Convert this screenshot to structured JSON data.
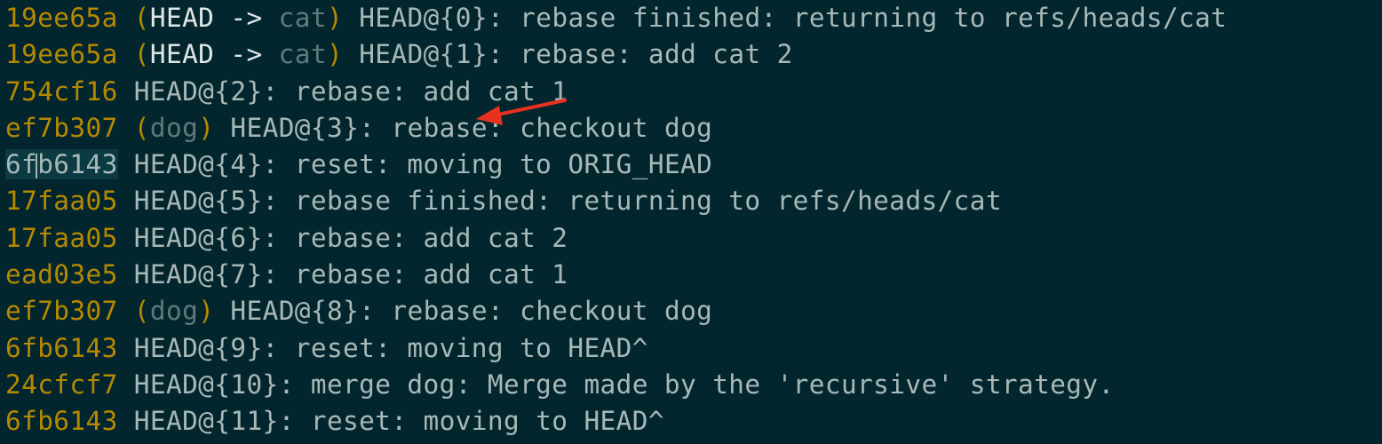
{
  "terminal": {
    "lines": [
      {
        "hash": "19ee65a",
        "open_paren": "(",
        "head": "HEAD",
        "arrow": " -> ",
        "branch": "cat",
        "close_paren": ")",
        "reflog": "HEAD@{0}:",
        "message": "rebase finished: returning to refs/heads/cat"
      },
      {
        "hash": "19ee65a",
        "open_paren": "(",
        "head": "HEAD",
        "arrow": " -> ",
        "branch": "cat",
        "close_paren": ")",
        "reflog": "HEAD@{1}:",
        "message": "rebase: add cat 2"
      },
      {
        "hash": "754cf16",
        "reflog": "HEAD@{2}:",
        "message": "rebase: add cat 1"
      },
      {
        "hash": "ef7b307",
        "open_paren": "(",
        "branch": "dog",
        "close_paren": ")",
        "reflog": "HEAD@{3}:",
        "message": "rebase: checkout dog"
      },
      {
        "hash_part1": "6f",
        "hash_part2": "b6143",
        "reflog": "HEAD@{4}:",
        "message": "reset: moving to ORIG_HEAD"
      },
      {
        "hash": "17faa05",
        "reflog": "HEAD@{5}:",
        "message": "rebase finished: returning to refs/heads/cat"
      },
      {
        "hash": "17faa05",
        "reflog": "HEAD@{6}:",
        "message": "rebase: add cat 2"
      },
      {
        "hash": "ead03e5",
        "reflog": "HEAD@{7}:",
        "message": "rebase: add cat 1"
      },
      {
        "hash": "ef7b307",
        "open_paren": "(",
        "branch": "dog",
        "close_paren": ")",
        "reflog": "HEAD@{8}:",
        "message": "rebase: checkout dog"
      },
      {
        "hash": "6fb6143",
        "reflog": "HEAD@{9}:",
        "message": "reset: moving to HEAD^"
      },
      {
        "hash": "24cfcf7",
        "reflog": "HEAD@{10}:",
        "message": "merge dog: Merge made by the 'recursive' strategy."
      },
      {
        "hash": "6fb6143",
        "reflog": "HEAD@{11}:",
        "message": "reset: moving to HEAD^"
      }
    ]
  },
  "colors": {
    "background": "#03262e",
    "hash": "#b58900",
    "text": "#a8b8b6",
    "branch": "#60797b",
    "annotation_arrow": "#e8321f"
  }
}
